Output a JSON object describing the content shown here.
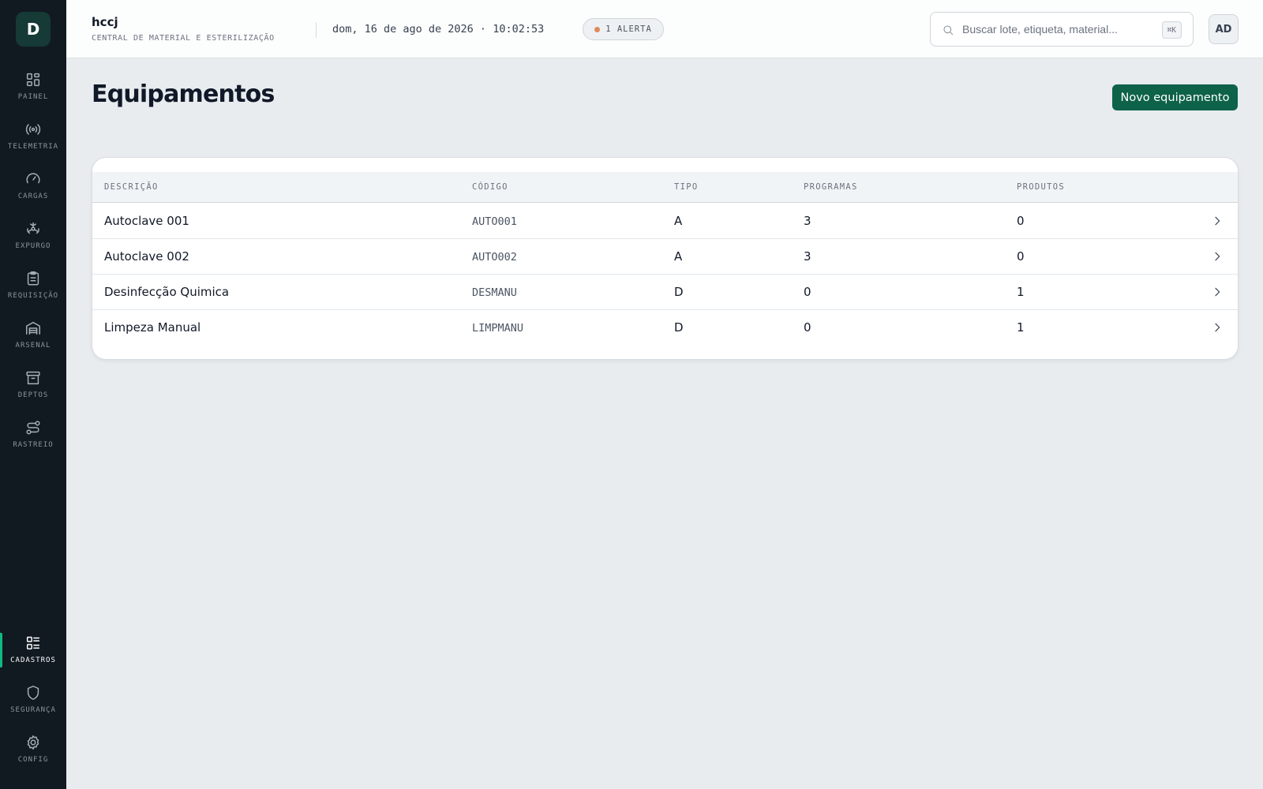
{
  "brand": {
    "logo_letter": "D"
  },
  "sidebar": {
    "items": [
      {
        "label": "PAINEL",
        "icon": "grid-icon"
      },
      {
        "label": "TELEMETRIA",
        "icon": "broadcast-icon"
      },
      {
        "label": "CARGAS",
        "icon": "gauge-icon"
      },
      {
        "label": "EXPURGO",
        "icon": "biohazard-icon"
      },
      {
        "label": "REQUISIÇÃO",
        "icon": "clipboard-icon"
      },
      {
        "label": "ARSENAL",
        "icon": "warehouse-icon"
      },
      {
        "label": "DEPTOS",
        "icon": "archive-icon"
      },
      {
        "label": "RASTREIO",
        "icon": "route-icon"
      }
    ],
    "bottom_items": [
      {
        "label": "CADASTROS",
        "icon": "list-icon",
        "active": true
      },
      {
        "label": "SEGURANÇA",
        "icon": "shield-icon"
      },
      {
        "label": "CONFIG",
        "icon": "gear-icon"
      }
    ]
  },
  "header": {
    "org_name": "hccj",
    "org_subtitle": "CENTRAL DE MATERIAL E ESTERILIZAÇÃO",
    "datetime": "dom, 16 de ago de 2026 · 10:02:53",
    "alert_label": "1 ALERTA",
    "alert_color": "#e08a5a",
    "search_placeholder": "Buscar lote, etiqueta, material...",
    "search_shortcut": "⌘K",
    "avatar_initials": "AD"
  },
  "main": {
    "title": "Equipamentos",
    "new_button_label": "Novo equipamento",
    "accent_color": "#0e6248"
  },
  "table": {
    "columns": [
      "DESCRIÇÃO",
      "CÓDIGO",
      "TIPO",
      "PROGRAMAS",
      "PRODUTOS"
    ],
    "rows": [
      {
        "descricao": "Autoclave 001",
        "codigo": "AUTO001",
        "tipo": "A",
        "programas": "3",
        "produtos": "0"
      },
      {
        "descricao": "Autoclave 002",
        "codigo": "AUTO002",
        "tipo": "A",
        "programas": "3",
        "produtos": "0"
      },
      {
        "descricao": "Desinfecção Quimica",
        "codigo": "DESMANU",
        "tipo": "D",
        "programas": "0",
        "produtos": "1"
      },
      {
        "descricao": "Limpeza Manual",
        "codigo": "LIMPMANU",
        "tipo": "D",
        "programas": "0",
        "produtos": "1"
      }
    ]
  }
}
